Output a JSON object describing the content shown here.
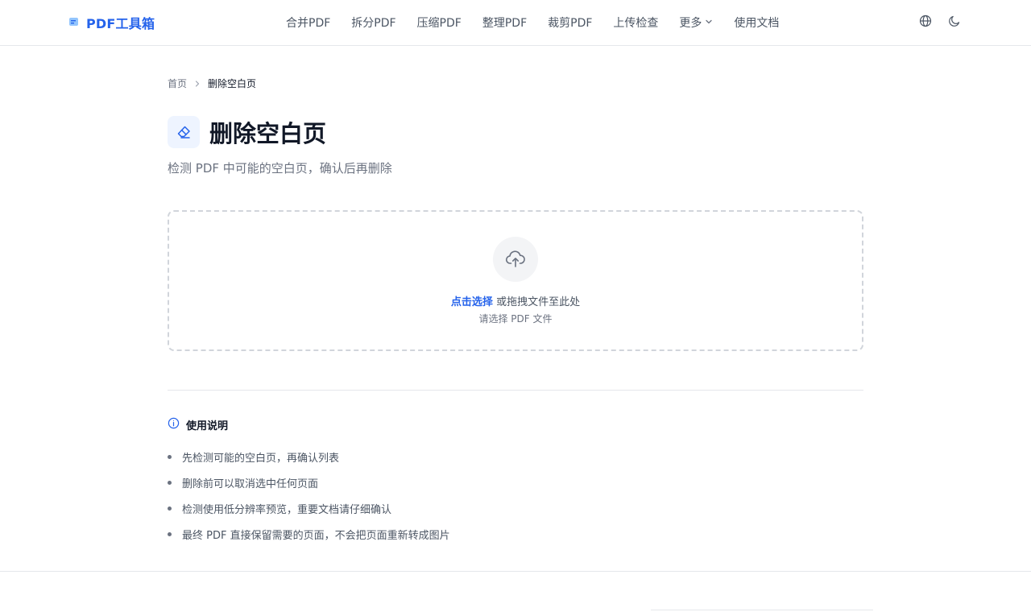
{
  "header": {
    "logo_text": "PDF工具箱",
    "nav": [
      {
        "label": "合并PDF"
      },
      {
        "label": "拆分PDF"
      },
      {
        "label": "压缩PDF"
      },
      {
        "label": "整理PDF"
      },
      {
        "label": "裁剪PDF"
      },
      {
        "label": "上传检查"
      },
      {
        "label": "更多"
      },
      {
        "label": "使用文档"
      }
    ],
    "actions": [
      "globe-icon",
      "moon-icon"
    ]
  },
  "breadcrumb": {
    "home": "首页",
    "current": "删除空白页"
  },
  "page": {
    "title": "删除空白页",
    "title_icon": "eraser-icon",
    "subtitle": "检测 PDF 中可能的空白页，确认后再删除"
  },
  "upload": {
    "icon": "upload-cloud-icon",
    "link_text": "点击选择",
    "hint_text": " 或拖拽文件至此处",
    "sub_text": "请选择 PDF 文件"
  },
  "usage": {
    "title": "使用说明",
    "items": [
      "先检测可能的空白页，再确认列表",
      "删除前可以取消选中任何页面",
      "检测使用低分辨率预览，重要文档请仔细确认",
      "最终 PDF 直接保留需要的页面，不会把页面重新转成图片"
    ]
  },
  "colors": {
    "accent": "#2563eb",
    "text_primary": "#111827",
    "text_secondary": "#6b7280",
    "border": "#e5e7eb"
  }
}
